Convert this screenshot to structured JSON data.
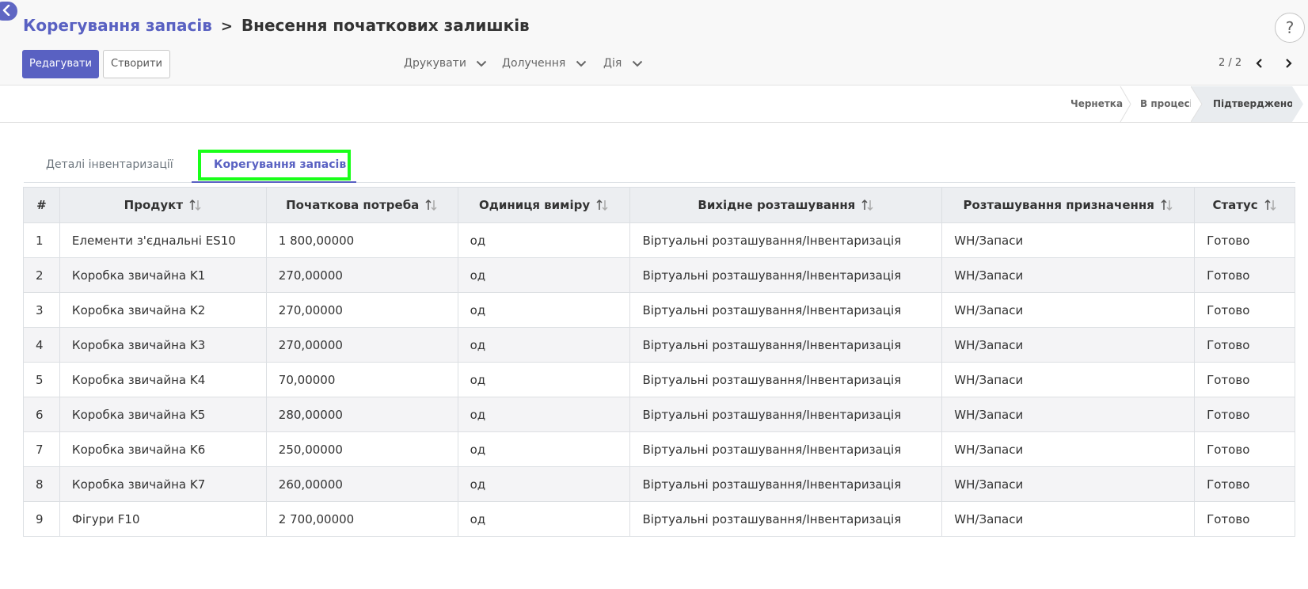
{
  "breadcrumb": {
    "parent": "Корегування запасів",
    "separator": ">",
    "current": "Внесення початкових залишків"
  },
  "toolbar": {
    "edit_label": "Редагувати",
    "create_label": "Створити"
  },
  "menus": {
    "print": "Друкувати",
    "attach": "Долучення",
    "action": "Дія"
  },
  "pager": {
    "value": "2 / 2"
  },
  "help": {
    "label": "?"
  },
  "status": {
    "stages": [
      "Чернетка",
      "В процесі",
      "Підтверджено"
    ],
    "active": "Підтверджено"
  },
  "tabs": [
    {
      "label": "Деталі інвентаризації"
    },
    {
      "label": "Корегування запасів"
    }
  ],
  "table": {
    "headers": [
      "#",
      "Продукт",
      "Початкова потреба",
      "Одиниця виміру",
      "Вихідне розташування",
      "Розташування призначення",
      "Статус"
    ],
    "rows": [
      [
        "1",
        "Елементи з'єднальні ES10",
        "1 800,00000",
        "од",
        "Віртуальні розташування/Інвентаризація",
        "WH/Запаси",
        "Готово"
      ],
      [
        "2",
        "Коробка звичайна K1",
        "270,00000",
        "од",
        "Віртуальні розташування/Інвентаризація",
        "WH/Запаси",
        "Готово"
      ],
      [
        "3",
        "Коробка звичайна K2",
        "270,00000",
        "од",
        "Віртуальні розташування/Інвентаризація",
        "WH/Запаси",
        "Готово"
      ],
      [
        "4",
        "Коробка звичайна K3",
        "270,00000",
        "од",
        "Віртуальні розташування/Інвентаризація",
        "WH/Запаси",
        "Готово"
      ],
      [
        "5",
        "Коробка звичайна K4",
        "70,00000",
        "од",
        "Віртуальні розташування/Інвентаризація",
        "WH/Запаси",
        "Готово"
      ],
      [
        "6",
        "Коробка звичайна K5",
        "280,00000",
        "од",
        "Віртуальні розташування/Інвентаризація",
        "WH/Запаси",
        "Готово"
      ],
      [
        "7",
        "Коробка звичайна K6",
        "250,00000",
        "од",
        "Віртуальні розташування/Інвентаризація",
        "WH/Запаси",
        "Готово"
      ],
      [
        "8",
        "Коробка звичайна K7",
        "260,00000",
        "од",
        "Віртуальні розташування/Інвентаризація",
        "WH/Запаси",
        "Готово"
      ],
      [
        "9",
        "Фігури F10",
        "2 700,00000",
        "од",
        "Віртуальні розташування/Інвентаризація",
        "WH/Запаси",
        "Готово"
      ]
    ]
  },
  "colors": {
    "brand": "#5961c2",
    "highlight": "#19ff19"
  },
  "icons": {
    "back": "back-arrow-icon",
    "sort": "sort-icon",
    "chevron": "chevron-down-icon"
  }
}
